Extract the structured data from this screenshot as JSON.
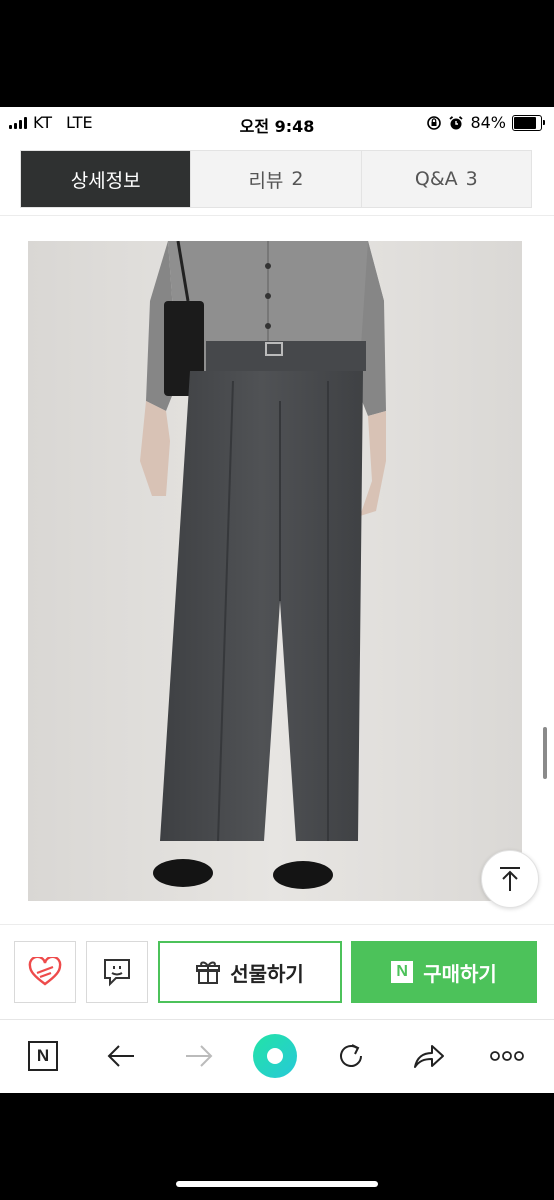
{
  "status_bar": {
    "carrier": "KT",
    "network": "LTE",
    "time": "오전 9:48",
    "battery": "84%",
    "battery_level": 0.84
  },
  "tabs": [
    {
      "label": "상세정보",
      "count": ""
    },
    {
      "label": "리뷰",
      "count": "2"
    },
    {
      "label": "Q&A",
      "count": "3"
    }
  ],
  "icons": {
    "scroll_top": "arrow-up-to-line-icon",
    "like": "heart-icon",
    "talk": "chat-icon",
    "gift": "gift-icon",
    "naver": "naver-n-icon"
  },
  "actions": {
    "gift_label": "선물하기",
    "buy_label": "구매하기",
    "buy_badge": "N"
  },
  "toolbar": {
    "home_badge": "N"
  },
  "colors": {
    "accent_green": "#4cc25a",
    "active_tab": "#2f3131"
  }
}
